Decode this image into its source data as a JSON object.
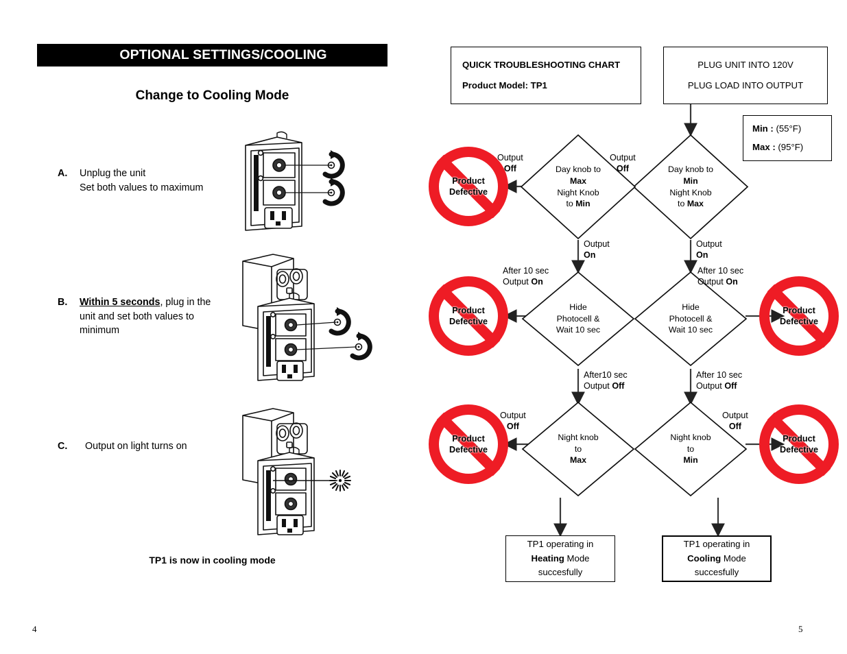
{
  "left_page": {
    "section_header": "OPTIONAL SETTINGS/COOLING",
    "subtitle": "Change to Cooling Mode",
    "steps": [
      {
        "letter": "A.",
        "lines": [
          "Unplug the unit",
          "Set both values to maximum"
        ],
        "figure": "device-knobs-rotate"
      },
      {
        "letter": "B.",
        "emphasis": "Within 5 seconds",
        "lines": [
          ", plug in the",
          "unit and set both values to",
          "minimum"
        ],
        "figure": "device-plugged-knobs-rotate"
      },
      {
        "letter": "C.",
        "lines": [
          "Output on  light turns on"
        ],
        "figure": "device-plugged-light-on"
      }
    ],
    "footnote": "TP1 is now in cooling mode",
    "page_number": "4"
  },
  "right_page": {
    "page_number": "5",
    "title_box": {
      "line1": "QUICK TROUBLESHOOTING CHART",
      "line2": "Product Model:  TP1"
    },
    "plug_box": {
      "line1": "PLUG UNIT INTO 120V",
      "line2": "PLUG LOAD INTO OUTPUT"
    },
    "minmax_box": {
      "min_label": "Min :",
      "min_value": "(55°F)",
      "max_label": "Max :",
      "max_value": "(95°F)"
    },
    "diamonds": [
      {
        "id": "d-right-1",
        "lines": [
          "Day knob to",
          "Min",
          "Night Knob",
          "to Max"
        ],
        "bold": [
          false,
          true,
          false,
          false
        ]
      },
      {
        "id": "d-left-1",
        "lines": [
          "Day knob to",
          "Max",
          "Night Knob",
          "to Min"
        ],
        "bold": [
          false,
          true,
          false,
          false
        ]
      },
      {
        "id": "d-right-2",
        "lines": [
          "Hide",
          "Photocell &",
          "Wait 10 sec"
        ],
        "bold": [
          false,
          false,
          false
        ]
      },
      {
        "id": "d-left-2",
        "lines": [
          "Hide",
          "Photocell &",
          "Wait 10 sec"
        ],
        "bold": [
          false,
          false,
          false
        ]
      },
      {
        "id": "d-right-3",
        "lines": [
          "Night knob",
          "to",
          "Min"
        ],
        "bold": [
          false,
          false,
          true
        ]
      },
      {
        "id": "d-left-3",
        "lines": [
          "Night knob",
          "to",
          "Max"
        ],
        "bold": [
          false,
          false,
          true
        ]
      }
    ],
    "edge_labels": {
      "r1_out_off": {
        "l1": "Output",
        "l2": "Off"
      },
      "l1_out_off": {
        "l1": "Output",
        "l2": "Off"
      },
      "r1_out_on": {
        "l1": "Output",
        "l2": "On"
      },
      "l1_out_on": {
        "l1": "Output",
        "l2": "On"
      },
      "r2_after_on": {
        "l1": "After 10 sec",
        "l2": "Output On"
      },
      "l2_after_on": {
        "l1": "After 10 sec",
        "l2": "Output On"
      },
      "r2_after_off": {
        "l1": "After 10 sec",
        "l2": "Output Off"
      },
      "l2_after_off": {
        "l1": "After10 sec",
        "l2": "Output Off"
      },
      "r3_out_off": {
        "l1": "Output",
        "l2": "Off"
      },
      "l3_out_off": {
        "l1": "Output",
        "l2": "Off"
      }
    },
    "defective_badges": [
      {
        "id": "bad-1",
        "line1": "Product",
        "line2": "Defective"
      },
      {
        "id": "bad-2",
        "line1": "Product",
        "line2": "Defective"
      },
      {
        "id": "bad-3",
        "line1": "Product",
        "line2": "Defective"
      },
      {
        "id": "bad-4",
        "line1": "Product",
        "line2": "Defective"
      },
      {
        "id": "bad-5",
        "line1": "Product",
        "line2": "Defective"
      },
      {
        "id": "bad-6",
        "line1": "Product",
        "line2": "Defective"
      }
    ],
    "result_boxes": {
      "heating": {
        "line1": "TP1 operating in",
        "mode": "Heating",
        "mode_suffix": " Mode",
        "line3": "succesfully"
      },
      "cooling": {
        "line1": "TP1 operating in",
        "mode": "Cooling",
        "mode_suffix": " Mode",
        "line3": "succesfully"
      }
    }
  },
  "colors": {
    "prohibition_red": "#ee1c25",
    "header_bar": "#000000",
    "page_background": "#ffffff"
  }
}
